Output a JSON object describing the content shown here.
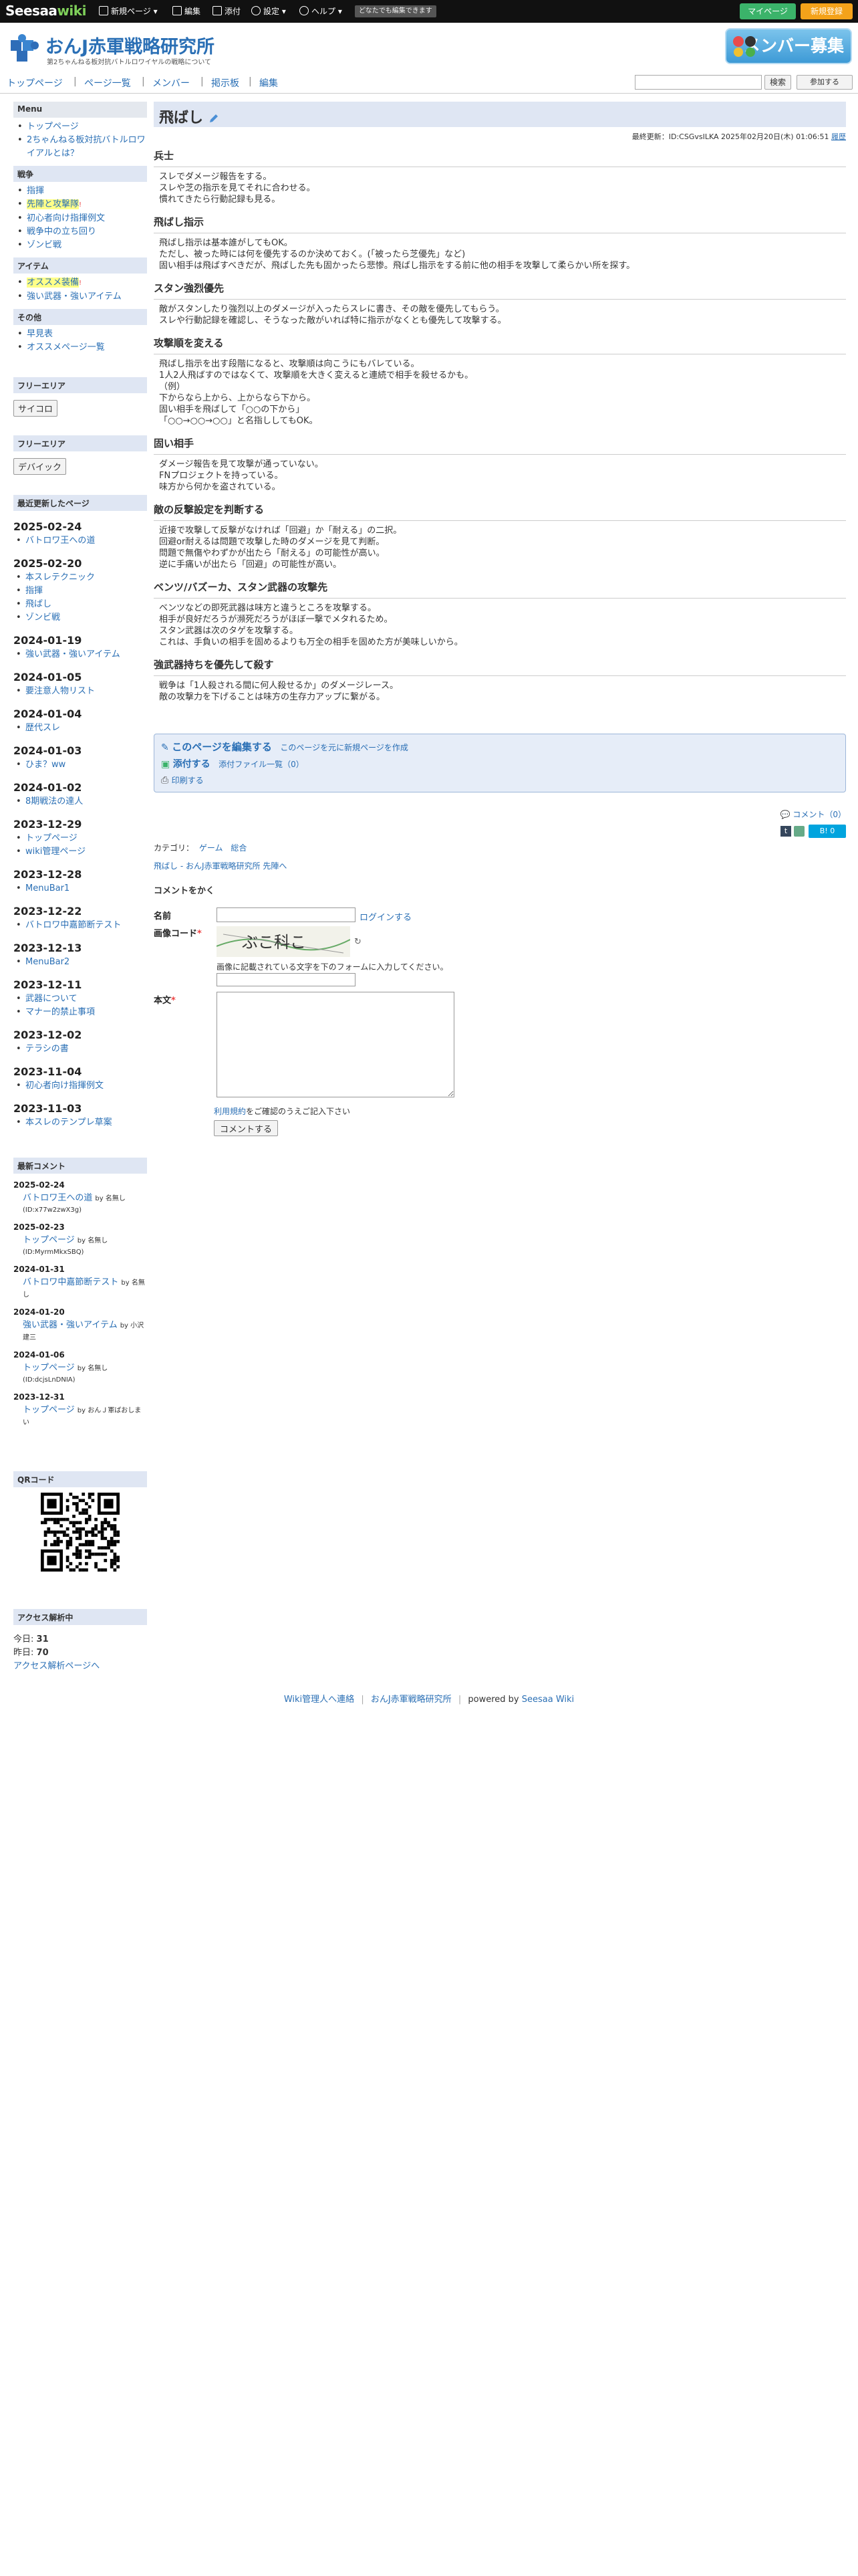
{
  "topbar": {
    "logo_main": "Seesaa",
    "logo_wiki": "wiki",
    "new_page": "新規ページ",
    "edit": "編集",
    "attach": "添付",
    "settings": "設定",
    "help": "ヘルプ",
    "anyone": "どなたでも編集できます",
    "mypage": "マイページ",
    "register": "新規登録"
  },
  "header": {
    "title": "おんJ赤軍戦略研究所",
    "subtitle": "第2ちゃんねる板対抗バトルロワイヤルの戦略について",
    "banner": "メンバー募集"
  },
  "nav": {
    "items": [
      "トップページ",
      "ページ一覧",
      "メンバー",
      "掲示板",
      "編集"
    ],
    "search_button": "検索",
    "join_button": "参加する"
  },
  "sidebar": {
    "menu_title": "Menu",
    "menu_items": [
      "トップページ",
      "2ちゃんねる板対抗バトルロワイアルとは？"
    ],
    "war_title": "戦争",
    "war_items": [
      "指揮",
      "先陣と攻撃隊",
      "初心者向け指揮例文",
      "戦争中の立ち回り",
      "ゾンビ戦"
    ],
    "item_title": "アイテム",
    "item_items": [
      "オススメ装備",
      "強い武器・強いアイテム"
    ],
    "other_title": "その他",
    "other_items": [
      "早見表",
      "オススメページ一覧"
    ],
    "free1_title": "フリーエリア",
    "free1_button": "サイコロ",
    "free2_title": "フリーエリア",
    "free2_button": "デバイック",
    "recent_title": "最近更新したページ",
    "recent": [
      {
        "date": "2025-02-24",
        "pages": [
          "バトロワ王への道"
        ]
      },
      {
        "date": "2025-02-20",
        "pages": [
          "本スレテクニック",
          "指揮",
          "飛ばし",
          "ゾンビ戦"
        ]
      },
      {
        "date": "2024-01-19",
        "pages": [
          "強い武器・強いアイテム"
        ]
      },
      {
        "date": "2024-01-05",
        "pages": [
          "要注意人物リスト"
        ]
      },
      {
        "date": "2024-01-04",
        "pages": [
          "歴代スレ"
        ]
      },
      {
        "date": "2024-01-03",
        "pages": [
          "ひま？ww"
        ]
      },
      {
        "date": "2024-01-02",
        "pages": [
          "8期戦法の達人"
        ]
      },
      {
        "date": "2023-12-29",
        "pages": [
          "トップページ",
          "wiki管理ページ"
        ]
      },
      {
        "date": "2023-12-28",
        "pages": [
          "MenuBar1"
        ]
      },
      {
        "date": "2023-12-22",
        "pages": [
          "バトロワ中嘉節断テスト"
        ]
      },
      {
        "date": "2023-12-13",
        "pages": [
          "MenuBar2"
        ]
      },
      {
        "date": "2023-12-11",
        "pages": [
          "武器について",
          "マナー的禁止事項"
        ]
      },
      {
        "date": "2023-12-02",
        "pages": [
          "テラシの書"
        ]
      },
      {
        "date": "2023-11-04",
        "pages": [
          "初心者向け指揮例文"
        ]
      },
      {
        "date": "2023-11-03",
        "pages": [
          "本スレのテンプレ草案"
        ]
      }
    ],
    "comments_title": "最新コメント",
    "comments": [
      {
        "date": "2025-02-24",
        "page": "バトロワ王への道",
        "by": "by 名無し",
        "sub": "(ID:x77w2zwX3g)"
      },
      {
        "date": "2025-02-23",
        "page": "トップページ",
        "by": "by 名無し",
        "sub": "(ID:MyrmMkxSBQ)"
      },
      {
        "date": "2024-01-31",
        "page": "バトロワ中嘉節断テスト",
        "by": "by 名無し",
        "sub": ""
      },
      {
        "date": "2024-01-20",
        "page": "強い武器・強いアイテム",
        "by": "by 小沢建三",
        "sub": ""
      },
      {
        "date": "2024-01-06",
        "page": "トップページ",
        "by": "by 名無し",
        "sub": "(ID:dcjsLnDNIA)"
      },
      {
        "date": "2023-12-31",
        "page": "トップページ",
        "by": "by おんＪ軍ばおしまい",
        "sub": ""
      }
    ],
    "qr_title": "QRコード",
    "access_title": "アクセス解析中",
    "today_label": "今日:",
    "today_value": "31",
    "yesterday_label": "昨日:",
    "yesterday_value": "70",
    "access_link": "アクセス解析ページへ"
  },
  "main": {
    "title": "飛ばし",
    "last_updated": "最終更新：ID:CSGvsILKA 2025年02月20日(木) 01:06:51",
    "history": "履歴",
    "sections": [
      {
        "heading": "兵士",
        "lines": [
          "スレでダメージ報告をする。",
          "スレや芝の指示を見てそれに合わせる。",
          "慣れてきたら行動記録も見る。"
        ]
      },
      {
        "heading": "飛ばし指示",
        "lines": [
          "飛ばし指示は基本誰がしてもOK。",
          "ただし、被った時には何を優先するのか決めておく。(「被ったら芝優先」など)",
          "固い相手は飛ばすべきだが、飛ばした先も固かったら悲惨。飛ばし指示をする前に他の相手を攻撃して柔らかい所を探す。"
        ]
      },
      {
        "heading": "スタン強烈優先",
        "lines": [
          "敵がスタンしたり強烈以上のダメージが入ったらスレに書き、その敵を優先してもらう。",
          "スレや行動記録を確認し、そうなった敵がいれば特に指示がなくとも優先して攻撃する。"
        ]
      },
      {
        "heading": "攻撃順を変える",
        "lines": [
          "飛ばし指示を出す段階になると、攻撃順は向こうにもバレている。",
          "1人2人飛ばすのではなくて、攻撃順を大きく変えると連続で相手を殺せるかも。",
          "（例）",
          "下からなら上から、上からなら下から。",
          "固い相手を飛ばして「○○の下から」",
          "「○○→○○→○○」と名指ししてもOK。"
        ]
      },
      {
        "heading": "固い相手",
        "lines": [
          "ダメージ報告を見て攻撃が通っていない。",
          "FNプロジェクトを持っている。",
          "味方から何かを盗されている。"
        ]
      },
      {
        "heading": "敵の反撃設定を判断する",
        "lines": [
          "近接で攻撃して反撃がなければ「回避」か「耐える」の二択。",
          "回避or耐えるは問題で攻撃した時のダメージを見て判断。",
          "問題で無傷やわずかが出たら「耐える」の可能性が高い。",
          "逆に手痛いが出たら「回避」の可能性が高い。"
        ]
      },
      {
        "heading": "ベンツ/バズーカ、スタン武器の攻撃先",
        "lines": [
          "ベンツなどの即死武器は味方と違うところを攻撃する。",
          "相手が良好だろうが瀕死だろうがほぼ一撃でメタれるため。",
          "スタン武器は次のタゲを攻撃する。",
          "これは、手負いの相手を固めるよりも万全の相手を固めた方が美味しいから。"
        ]
      },
      {
        "heading": "強武器持ちを優先して殺す",
        "lines": [
          "戦争は「1人殺される間に何人殺せるか」のダメージレース。",
          "敵の攻撃力を下げることは味方の生存力アップに繋がる。"
        ]
      }
    ],
    "edit_page": "このページを編集する",
    "new_from_page": "このページを元に新規ページを作成",
    "attach": "添付する",
    "attach_list": "添付ファイル一覧（0）",
    "print": "印刷する",
    "comment_link": "コメント（0）",
    "category_label": "カテゴリ：",
    "categories": [
      "ゲーム",
      "総合"
    ],
    "breadcrumb": "飛ばし - おんJ赤軍戦略研究所 先陣へ",
    "share_count": "0"
  },
  "form": {
    "title": "コメントをかく",
    "name_label": "名前",
    "login": "ログインする",
    "captcha_label": "画像コード",
    "captcha_text": "ぶこ科こ",
    "captcha_hint": "画像に記載されている文字を下のフォームに入力してください。",
    "body_label": "本文",
    "terms": "利用規約",
    "terms_suffix": "をご確認のうえご記入下さい",
    "submit": "コメントする"
  },
  "footer": {
    "contact": "Wiki管理人へ連絡",
    "site": "おんJ赤軍戦略研究所",
    "powered": "powered by",
    "seesaa": "Seesaa Wiki"
  },
  "colors": {
    "accent": "#2a6fb5",
    "sidebar_head": "#dfe6f3",
    "mypage": "#3bb36a",
    "register": "#f4a21a"
  }
}
